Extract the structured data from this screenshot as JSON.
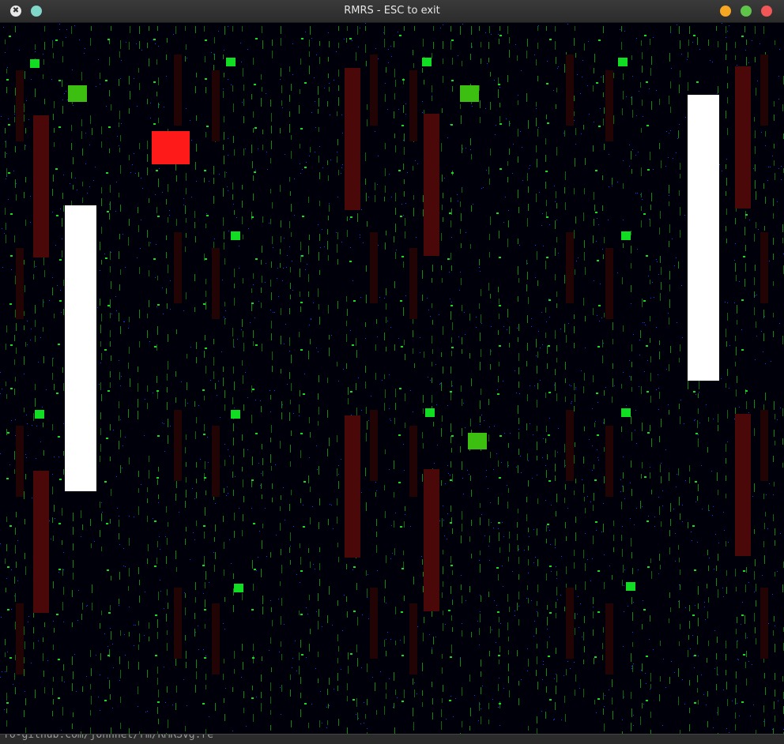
{
  "window": {
    "title": "RMRS - ESC to exit",
    "status_text": "fo-github.com/johnnet/rm/RMRSvg.re",
    "app_icon": "x-app-icon",
    "controls": {
      "sticky_color": "#7fd6c9",
      "minimize_color": "#f6a623",
      "maximize_color": "#5fc44a",
      "close_color": "#f25757"
    }
  },
  "game": {
    "background_color": "#00000a",
    "rain_colors": [
      "#0a6a0a",
      "#0f8a0f",
      "#1a3cff"
    ],
    "pellet_color": "#11dd22",
    "block_color": "#3cbf10",
    "player_color": "#ff1a1a",
    "paddle_color": "#ffffff",
    "pillar_color": "#4a0808",
    "pillar_shadow_color": "#220404"
  }
}
